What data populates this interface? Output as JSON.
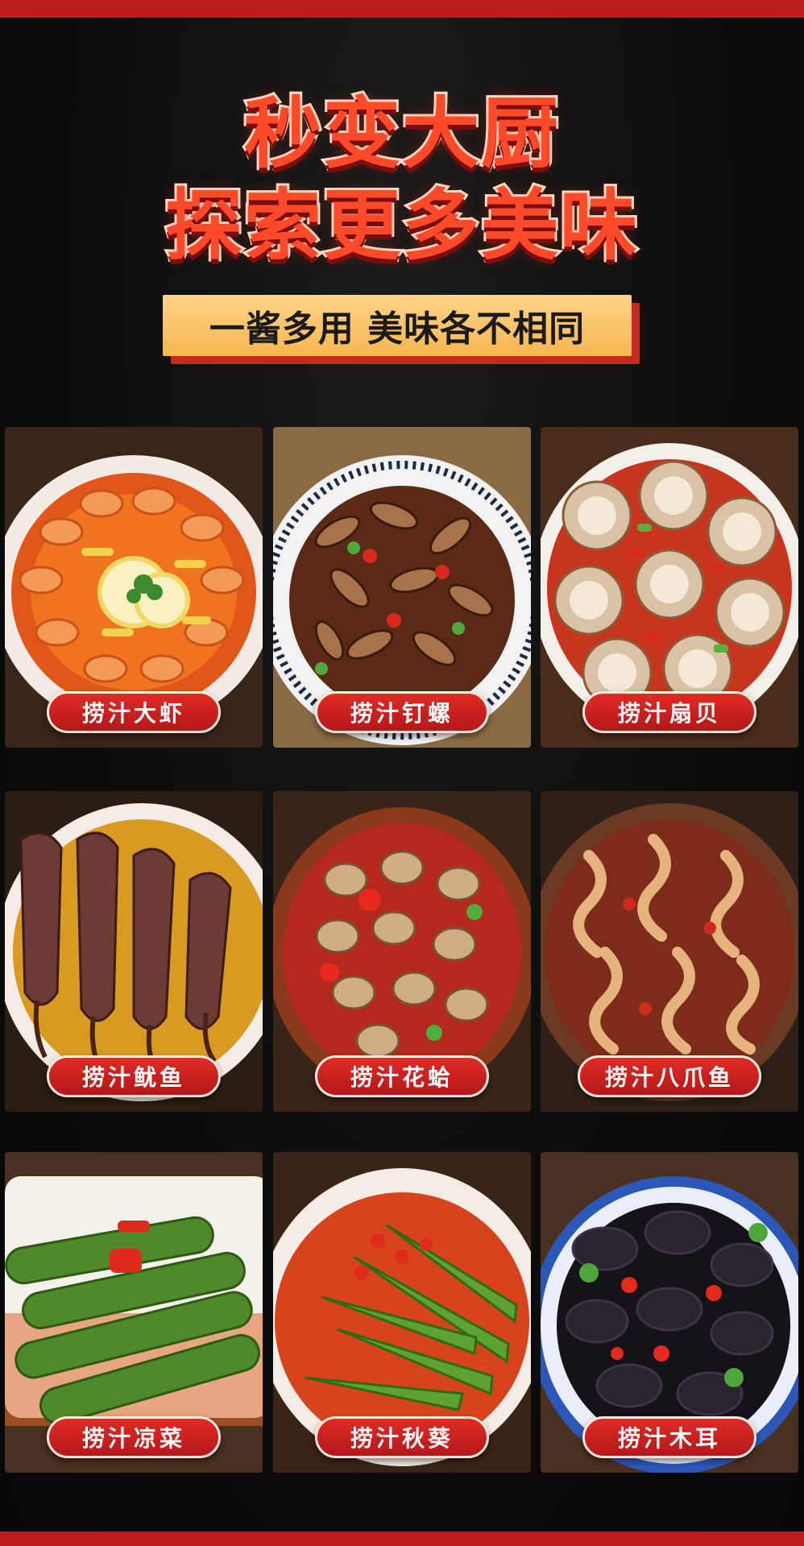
{
  "headline": {
    "line1": "秒变大厨",
    "line2": "探索更多美味"
  },
  "banner": {
    "text": "一酱多用 美味各不相同"
  },
  "dishes": [
    {
      "label": "捞汁大虾",
      "icon": "shrimp-dish-photo"
    },
    {
      "label": "捞汁钉螺",
      "icon": "snail-dish-photo"
    },
    {
      "label": "捞汁扇贝",
      "icon": "scallop-dish-photo"
    },
    {
      "label": "捞汁鱿鱼",
      "icon": "squid-dish-photo"
    },
    {
      "label": "捞汁花蛤",
      "icon": "clam-dish-photo"
    },
    {
      "label": "捞汁八爪鱼",
      "icon": "octopus-dish-photo"
    },
    {
      "label": "捞汁凉菜",
      "icon": "cucumber-dish-photo"
    },
    {
      "label": "捞汁秋葵",
      "icon": "okra-dish-photo"
    },
    {
      "label": "捞汁木耳",
      "icon": "fungus-dish-photo"
    }
  ],
  "colors": {
    "background": "#0b0b0b",
    "accent_red": "#c42a1d",
    "headline_red": "#ff4a2a",
    "banner_gold": "#f7b650"
  }
}
